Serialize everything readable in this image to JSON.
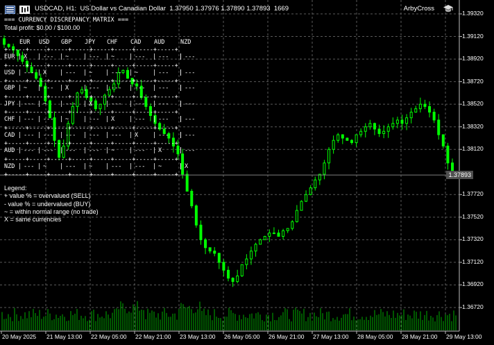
{
  "header": {
    "symbol_info": "USDCAD, H1:  US Dollar vs Canadian Dollar  1.37950 1.37976 1.37890 1.37893  1669",
    "ea_name": "ArbyCross",
    "icons": [
      "chart-menu-icon",
      "bar-type-icon",
      "ea-hat-icon"
    ]
  },
  "matrix": {
    "title": "=== CURRENCY DISCREPANCY MATRIX ===",
    "profit": "Total profit: $0.00 / $100.00",
    "currencies": [
      "EUR",
      "USD",
      "GBP",
      "JPY",
      "CHF",
      "CAD",
      "AUD",
      "NZD"
    ],
    "rows": [
      {
        "label": "EUR",
        "cells": [
          "X",
          "---",
          "~",
          "---",
          "~",
          "---",
          "---",
          "---"
        ]
      },
      {
        "label": "USD",
        "cells": [
          "---",
          "X",
          "---",
          "~",
          "---",
          "~",
          "---",
          "---"
        ]
      },
      {
        "label": "GBP",
        "cells": [
          "~",
          "---",
          "X",
          "---",
          "---",
          "---",
          "---",
          "---"
        ]
      },
      {
        "label": "JPY",
        "cells": [
          "---",
          "~",
          "---",
          "X",
          "---",
          "---",
          "---",
          "---"
        ]
      },
      {
        "label": "CHF",
        "cells": [
          "---",
          "---",
          "~",
          "---",
          "X",
          "---",
          "---",
          "---"
        ]
      },
      {
        "label": "CAD",
        "cells": [
          "---",
          "---",
          "---",
          "---",
          "---",
          "X",
          "---",
          "---"
        ]
      },
      {
        "label": "AUD",
        "cells": [
          "---",
          "---",
          "---",
          "---",
          "~",
          "---",
          "X",
          "---"
        ]
      },
      {
        "label": "NZD",
        "cells": [
          "---",
          "~",
          "---",
          "~",
          "---",
          "---",
          "~",
          "X"
        ]
      }
    ]
  },
  "legend": {
    "title": "Legend:",
    "lines": [
      "+ value % = overvalued (SELL)",
      "- value % = undervalued (BUY)",
      "~ = within normal range (no trade)",
      "X = same currencies"
    ]
  },
  "price_axis": [
    "1.39320",
    "1.39120",
    "1.38920",
    "1.38720",
    "1.38520",
    "1.38320",
    "1.38120",
    "1.37720",
    "1.37520",
    "1.37320",
    "1.37120",
    "1.36920",
    "1.36720"
  ],
  "current_price": "1.37893",
  "time_axis": [
    "20 May 2025",
    "21 May 13:00",
    "22 May 05:00",
    "22 May 21:00",
    "23 May 13:00",
    "26 May 05:00",
    "26 May 21:00",
    "27 May 13:00",
    "28 May 05:00",
    "28 May 21:00",
    "29 May 13:00"
  ],
  "colors": {
    "background": "#000000",
    "candles": "#00ff00",
    "grid": "#5a5a5a",
    "volume": "#00b000",
    "price_line": "#808080"
  },
  "chart_data": {
    "type": "candlestick",
    "symbol": "USDCAD",
    "timeframe": "H1",
    "ylim": [
      1.3672,
      1.3932
    ],
    "close_path": [
      1.391,
      1.3905,
      1.3903,
      1.39,
      1.3895,
      1.389,
      1.3885,
      1.388,
      1.3875,
      1.3868,
      1.3855,
      1.384,
      1.382,
      1.3805,
      1.3815,
      1.3835,
      1.385,
      1.3862,
      1.3865,
      1.3858,
      1.3855,
      1.3848,
      1.3852,
      1.386,
      1.3865,
      1.387,
      1.388,
      1.3882,
      1.3875,
      1.387,
      1.3868,
      1.3858,
      1.385,
      1.3842,
      1.3835,
      1.383,
      1.3826,
      1.3822,
      1.3815,
      1.3808,
      1.379,
      1.3775,
      1.3762,
      1.3745,
      1.3732,
      1.3725,
      1.3722,
      1.372,
      1.3712,
      1.3705,
      1.3698,
      1.3695,
      1.37,
      1.371,
      1.3715,
      1.3722,
      1.3728,
      1.3732,
      1.3735,
      1.3738,
      1.3738,
      1.3735,
      1.374,
      1.3742,
      1.3748,
      1.3758,
      1.3766,
      1.3772,
      1.3778,
      1.3785,
      1.379,
      1.38,
      1.3812,
      1.382,
      1.3825,
      1.3822,
      1.382,
      1.3818,
      1.3825,
      1.3828,
      1.3832,
      1.3835,
      1.383,
      1.3826,
      1.3828,
      1.3832,
      1.3835,
      1.3838,
      1.3835,
      1.384,
      1.3845,
      1.3848,
      1.3852,
      1.385,
      1.3845,
      1.3838,
      1.3825,
      1.3815,
      1.38,
      1.3789
    ],
    "volume_profile": "mostly even; spikes near 22 May 05:00 and 23 May 13:00"
  }
}
